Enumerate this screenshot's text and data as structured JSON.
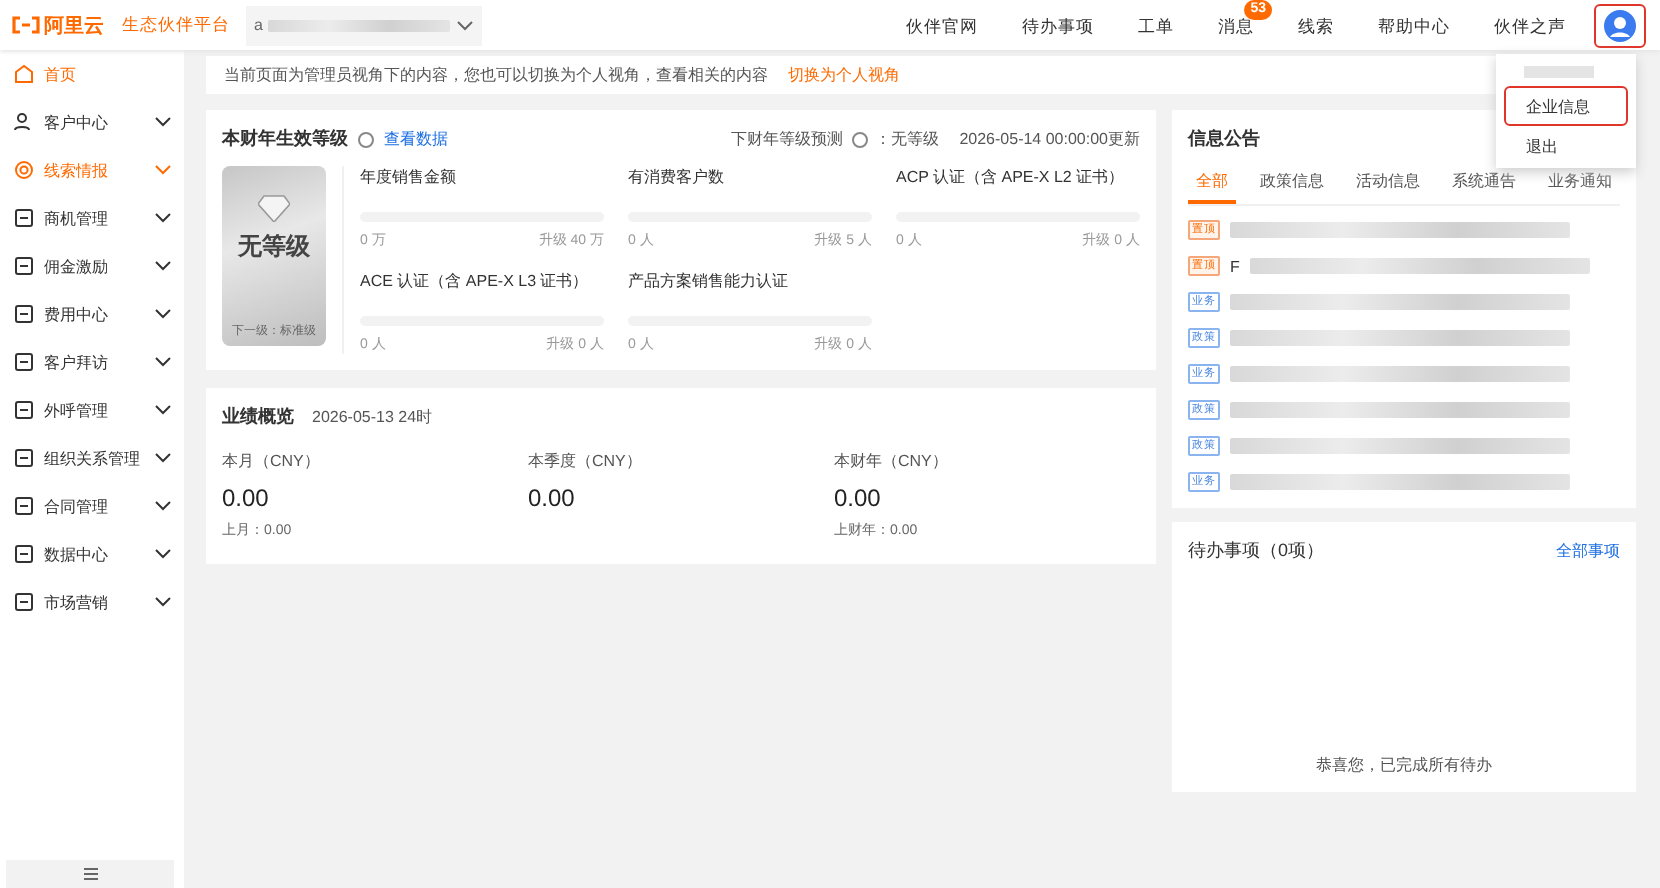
{
  "header": {
    "logo": "阿里云",
    "platform": "生态伙伴平台",
    "account": "a",
    "nav": [
      {
        "label": "伙伴官网"
      },
      {
        "label": "待办事项"
      },
      {
        "label": "工单"
      },
      {
        "label": "消息",
        "badge": "53"
      },
      {
        "label": "线索"
      },
      {
        "label": "帮助中心"
      },
      {
        "label": "伙伴之声"
      }
    ]
  },
  "user_menu": {
    "items": [
      {
        "label": "企业信息",
        "highlighted": true
      },
      {
        "label": "退出",
        "highlighted": false
      }
    ]
  },
  "sidebar": {
    "items": [
      {
        "label": "首页",
        "selected": true,
        "expandable": false
      },
      {
        "label": "客户中心",
        "selected": false,
        "expandable": true
      },
      {
        "label": "线索情报",
        "selected": true,
        "expandable": true
      },
      {
        "label": "商机管理",
        "selected": false,
        "expandable": true
      },
      {
        "label": "佣金激励",
        "selected": false,
        "expandable": true
      },
      {
        "label": "费用中心",
        "selected": false,
        "expandable": true
      },
      {
        "label": "客户拜访",
        "selected": false,
        "expandable": true
      },
      {
        "label": "外呼管理",
        "selected": false,
        "expandable": true
      },
      {
        "label": "组织关系管理",
        "selected": false,
        "expandable": true
      },
      {
        "label": "合同管理",
        "selected": false,
        "expandable": true
      },
      {
        "label": "数据中心",
        "selected": false,
        "expandable": true
      },
      {
        "label": "市场营销",
        "selected": false,
        "expandable": true
      }
    ]
  },
  "banner": {
    "text": "当前页面为管理员视角下的内容，您也可以切换为个人视角，查看相关的内容",
    "link": "切换为个人视角"
  },
  "level_card": {
    "title": "本财年生效等级",
    "link": "查看数据",
    "forecast_label": "下财年等级预测",
    "forecast_value": "：无等级",
    "updated": "2026-05-14 00:00:00更新",
    "badge_level": "无等级",
    "next_level": "下一级：标准级",
    "metrics": [
      {
        "name": "年度销售金额",
        "current": "0 万",
        "target": "升级 40 万",
        "level": 0
      },
      {
        "name": "有消费客户数",
        "current": "0 人",
        "target": "升级 5 人",
        "level": 0
      },
      {
        "name": "ACP 认证（含 APE-X L2 证书）",
        "current": "0 人",
        "target": "升级 0 人",
        "level": 0
      },
      {
        "name": "ACE 认证（含 APE-X L3 证书）",
        "current": "0 人",
        "target": "升级 0 人",
        "level": 0
      },
      {
        "name": "产品方案销售能力认证",
        "current": "0 人",
        "target": "升级 0 人",
        "level": 0
      }
    ]
  },
  "performance": {
    "title": "业绩概览",
    "date": "2026-05-13 24时",
    "stats": [
      {
        "label": "本月（CNY）",
        "value": "0.00",
        "previous": "上月：0.00"
      },
      {
        "label": "本季度（CNY）",
        "value": "0.00"
      },
      {
        "label": "本财年（CNY）",
        "value": "0.00",
        "previous": "上财年：0.00"
      }
    ]
  },
  "notices": {
    "title": "信息公告",
    "tabs": [
      {
        "label": "全部",
        "selected": true
      },
      {
        "label": "政策信息",
        "selected": false
      },
      {
        "label": "活动信息",
        "selected": false
      },
      {
        "label": "系统通告",
        "selected": false
      },
      {
        "label": "业务通知",
        "selected": false
      }
    ],
    "items": [
      {
        "tag": "置顶",
        "kind": "pinned"
      },
      {
        "tag": "置顶",
        "kind": "pinned",
        "title": "F"
      },
      {
        "tag": "业务",
        "kind": "normal"
      },
      {
        "tag": "政策",
        "kind": "normal"
      },
      {
        "tag": "业务",
        "kind": "normal"
      },
      {
        "tag": "政策",
        "kind": "normal"
      },
      {
        "tag": "政策",
        "kind": "normal"
      },
      {
        "tag": "业务",
        "kind": "normal"
      }
    ]
  },
  "todo": {
    "title": "待办事项（0项）",
    "link": "全部事项",
    "empty": "恭喜您，已完成所有待办"
  }
}
